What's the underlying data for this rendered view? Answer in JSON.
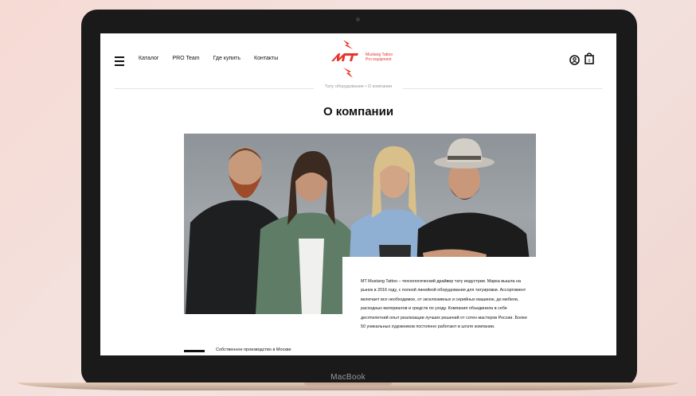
{
  "device": {
    "label": "MacBook"
  },
  "header": {
    "nav": [
      "Каталог",
      "PRO Team",
      "Где купить",
      "Контакты"
    ],
    "logo": {
      "mark": "MT",
      "line1": "Mustang Tattoo",
      "line2": "Pro equipment"
    },
    "cart_count": "0"
  },
  "breadcrumb": {
    "text": "Тату оборудование • О компании"
  },
  "page": {
    "title": "О компании",
    "about": "MT Mustang Tattoo – технологический драйвер тату индустрии. Марка вышла на рынок в 2016 году, с полной линейкой оборудования для татуировки. Ассортимент включает все необходимое, от эксклюзивных и серийных машинок, до мебели, расходных материалов и средств по уходу. Компания объединила в себе десятилетний опыт реализации лучших решений от сотен мастеров России. Более 50 уникальных художников постоянно работают в штате компании.",
    "feature": "Собственное производство в Москве"
  },
  "colors": {
    "accent": "#e6362b",
    "text": "#111111"
  }
}
